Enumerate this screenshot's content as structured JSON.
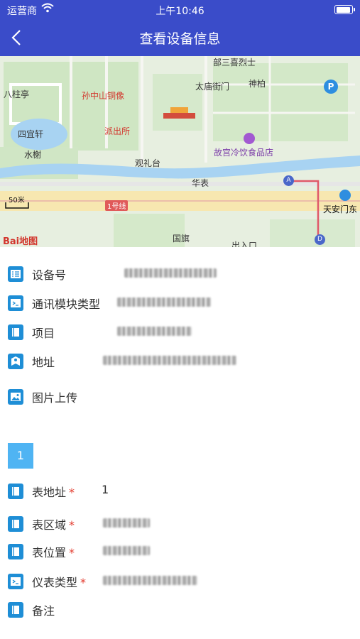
{
  "status_bar": {
    "carrier": "运营商",
    "time": "上午10:46"
  },
  "nav": {
    "title": "查看设备信息",
    "back_icon": "chevron-left-icon"
  },
  "map": {
    "labels": {
      "bashan": "部三喜烈士",
      "bazhuting": "八柱亭",
      "sunzhongshan": "孙中山铜像",
      "taimiao": "太庙街门",
      "shenbo": "神柏",
      "siyixuan": "四宜轩",
      "paichusuo": "派出所",
      "shuixie": "水榭",
      "gugong": "故宫冷饮食品店",
      "guanlitai": "观礼台",
      "huabiao": "华表",
      "scale": "50米",
      "line1": "1号线",
      "tiananmen": "天安门东",
      "guoqi": "国旗",
      "churukou": "出入口",
      "baidu_logo": "Bai地图"
    },
    "parking_marker": "P",
    "pin_a": "A",
    "pin_d": "D"
  },
  "device": {
    "id": {
      "label": "设备号"
    },
    "module": {
      "label": "通讯模块类型"
    },
    "project": {
      "label": "项目"
    },
    "address": {
      "label": "地址"
    },
    "photo": {
      "label": "图片上传"
    }
  },
  "meter_section": {
    "index": "1",
    "address": {
      "label": "表地址",
      "value": "1"
    },
    "area": {
      "label": "表区域"
    },
    "position": {
      "label": "表位置"
    },
    "type": {
      "label": "仪表类型"
    },
    "note": {
      "label": "备注"
    },
    "required_mark": "*"
  }
}
